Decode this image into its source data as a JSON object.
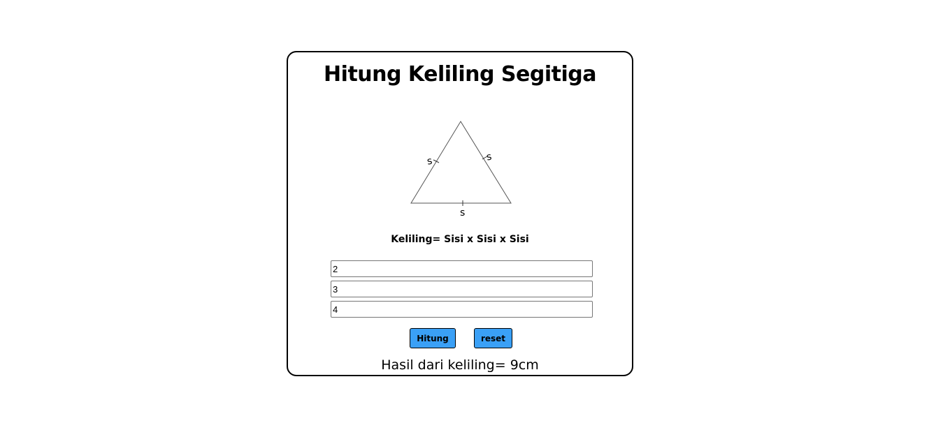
{
  "page": {
    "title": "Hitung Keliling Segitiga",
    "formula": "Keliling= Sisi x Sisi x Sisi"
  },
  "diagram": {
    "side_labels": [
      "s",
      "s",
      "s"
    ]
  },
  "form": {
    "inputs": [
      {
        "value": "2"
      },
      {
        "value": "3"
      },
      {
        "value": "4"
      }
    ],
    "buttons": {
      "hitung_label": "Hitung",
      "reset_label": "reset",
      "color": "#3aa0f6"
    }
  },
  "result": {
    "text": "Hasil dari keliling= 9cm"
  }
}
